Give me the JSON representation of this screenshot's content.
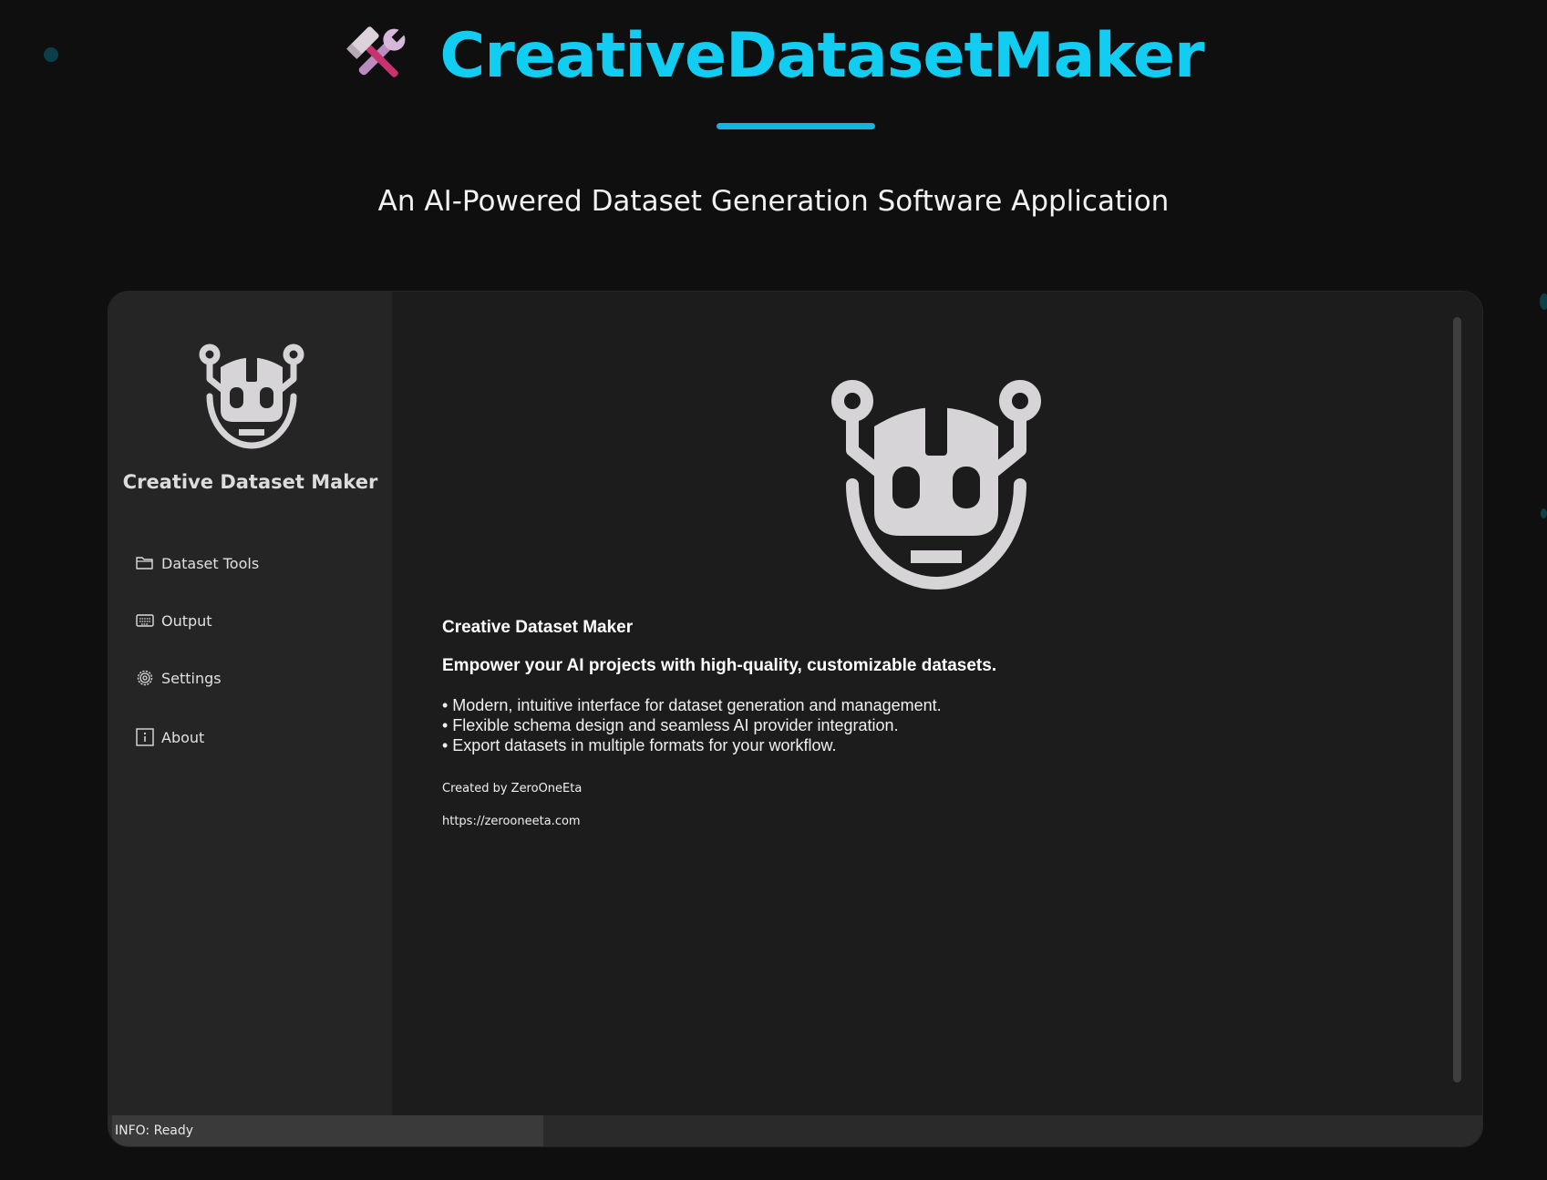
{
  "hero": {
    "title": "CreativeDatasetMaker",
    "subtitle": "An AI-Powered Dataset Generation Software Application",
    "icon": "hammer-and-wrench-icon",
    "accent_color": "#12cdf2"
  },
  "app": {
    "sidebar": {
      "app_name": "Creative Dataset Maker",
      "logo_icon": "robot-head-icon",
      "items": [
        {
          "label": "Dataset Tools",
          "icon": "folder-icon"
        },
        {
          "label": "Output",
          "icon": "keyboard-icon"
        },
        {
          "label": "Settings",
          "icon": "gear-icon"
        },
        {
          "label": "About",
          "icon": "info-icon"
        }
      ]
    },
    "main": {
      "logo_icon": "robot-head-icon",
      "title": "Creative Dataset Maker",
      "tagline": "Empower your AI projects with high-quality, customizable datasets.",
      "features": [
        "• Modern, intuitive interface for dataset generation and management.",
        "• Flexible schema design and seamless AI provider integration.",
        "• Export datasets in multiple formats for your workflow."
      ],
      "created_by": "Created by ZeroOneEta",
      "url": "https://zerooneeta.com"
    },
    "status": {
      "text": "INFO: Ready"
    }
  },
  "colors": {
    "background": "#0f0f10",
    "sidebar": "#252526",
    "main": "#1c1c1d",
    "logo": "#d6d4d6"
  }
}
